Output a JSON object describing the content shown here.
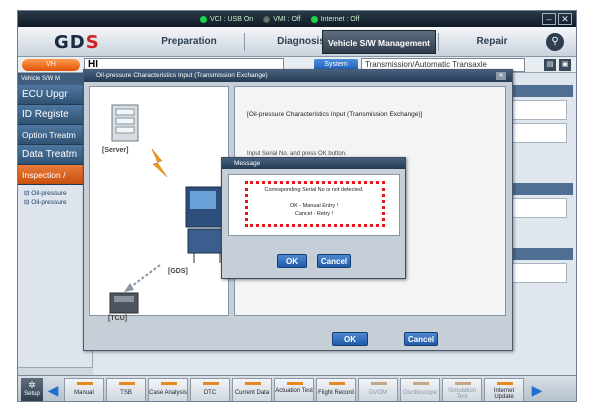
{
  "status": {
    "vci": "VCI : USB On",
    "vmi": "VMI : Off",
    "internet": "Internet : Off",
    "min_icon": "minimize-icon",
    "close_icon": "close-icon"
  },
  "header": {
    "logo_main": "GD",
    "logo_accent": "S",
    "tabs": [
      "Preparation",
      "Diagnosis",
      "Vehicle S/W Management",
      "Repair"
    ],
    "active_tab": "Vehicle S/W Management"
  },
  "vehicle_bar": {
    "vh_label": "VH",
    "vehicle": "HI",
    "system_label": "System",
    "system_value": "Transmission/Automatic Transaxle"
  },
  "sidebar": {
    "header": "Vehicle S/W M",
    "items": [
      "ECU Upgr",
      "ID Registe",
      "Option Treatm",
      "Data Treatm",
      "Inspection /"
    ],
    "sub_items": [
      "Oil-pressure",
      "Oil-pressure"
    ]
  },
  "dialog": {
    "title": "Oil-pressure Characteristics Input (Transmission Exchange)",
    "heading": "[Oil-pressure Characteristics Input (Transmission Exchange)]",
    "body_text": "Input Serial No. and press OK button.",
    "server_label": "[Server]",
    "gds_label": "[GDS]",
    "tcu_label": "[TCU]",
    "ok": "OK",
    "cancel": "Cancel"
  },
  "message": {
    "title": "Message",
    "line1": "Corresponding Serial No is not detected.",
    "line2": "OK - Manual Entry !",
    "line3": "Cancel - Retry !",
    "ok": "OK",
    "cancel": "Cancel"
  },
  "toolbar": {
    "setup": "Setup",
    "items": [
      "Manual",
      "TSB",
      "Case Analysis",
      "DTC",
      "Current Data",
      "Actuation Test",
      "Flight Record",
      "DVOM",
      "Oscilloscope",
      "Simulation Test",
      "Internet Update"
    ]
  }
}
